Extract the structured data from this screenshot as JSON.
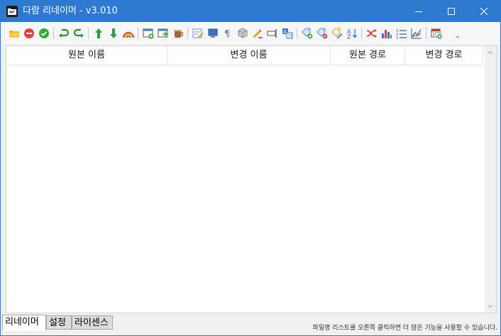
{
  "window": {
    "title": "다람 리네이머 - v3.010",
    "accent": "#2b79d0"
  },
  "window_controls": [
    "minimize-icon",
    "maximize-icon",
    "close-icon"
  ],
  "toolbar": {
    "buttons": [
      {
        "icon": "folder-open-icon",
        "color": "#e8b830"
      },
      {
        "icon": "remove-icon",
        "color": "#e04040"
      },
      {
        "icon": "apply-check-icon",
        "color": "#2faa3a"
      },
      {
        "icon": "undo-icon",
        "color": "#2f8f2f"
      },
      {
        "icon": "redo-icon",
        "color": "#2f8f2f"
      },
      {
        "icon": "move-up-icon",
        "color": "#2f9f3a"
      },
      {
        "icon": "move-down-icon",
        "color": "#2f9f3a"
      },
      {
        "icon": "rainbow-icon",
        "color": "#e05030"
      },
      {
        "icon": "add-window-icon",
        "color": "#3a7bd5"
      },
      {
        "icon": "import-window-icon",
        "color": "#3a7bd5"
      },
      {
        "icon": "mug-icon",
        "color": "#a06a3a"
      },
      {
        "icon": "edit-note-icon",
        "color": "#6a8fd8"
      },
      {
        "icon": "blue-window-icon",
        "color": "#3a6fd0"
      },
      {
        "icon": "paragraph-icon",
        "color": "#6a7fa8"
      },
      {
        "icon": "cube-icon",
        "color": "#8a8a8a"
      },
      {
        "icon": "pencil-icon",
        "color": "#e0a020"
      },
      {
        "icon": "text-field-icon",
        "color": "#555555"
      },
      {
        "icon": "translate-icon",
        "color": "#3a7bd5"
      },
      {
        "icon": "tag-add-icon",
        "color": "#4a8fd8"
      },
      {
        "icon": "tag-remove-icon",
        "color": "#4a8fd8"
      },
      {
        "icon": "tag-edit-icon",
        "color": "#d8a020"
      },
      {
        "icon": "sort-az-icon",
        "color": "#3a7bd5"
      },
      {
        "icon": "shuffle-icon",
        "color": "#d03030"
      },
      {
        "icon": "bar-chart-icon",
        "color": "#3a6fd0"
      },
      {
        "icon": "numbered-list-icon",
        "color": "#3a5fa0"
      },
      {
        "icon": "line-chart-icon",
        "color": "#3a6fd0"
      },
      {
        "icon": "calendar-add-icon",
        "color": "#d03030"
      }
    ],
    "more_glyph": "⌄"
  },
  "list": {
    "columns": [
      "원본 이름",
      "변경 이름",
      "원본 경로",
      "변경 경로"
    ],
    "rows": []
  },
  "tabs": [
    {
      "label": "리네이머",
      "active": true
    },
    {
      "label": "설정",
      "active": false
    },
    {
      "label": "라이센스",
      "active": false
    }
  ],
  "status_text": "파일명 리스트를 오른쪽 클릭하면 더 많은 기능을 사용할 수 있습니다."
}
